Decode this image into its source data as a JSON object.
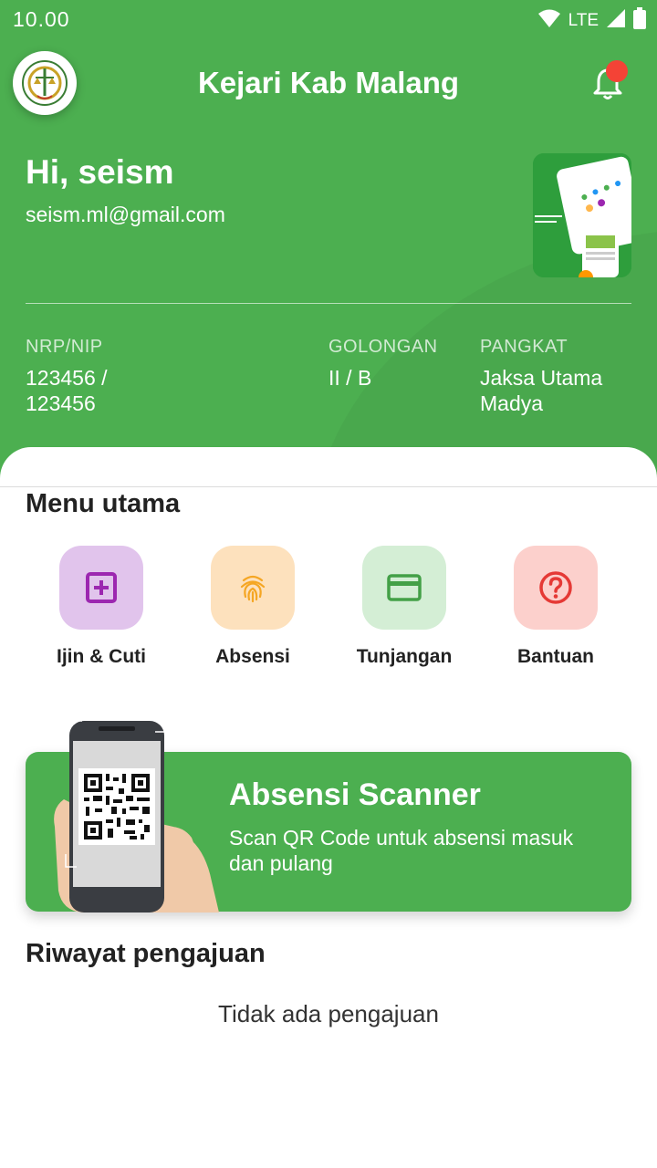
{
  "status_bar": {
    "time": "10.00",
    "network": "LTE",
    "icons": [
      "wifi-icon",
      "signal-icon",
      "battery-icon"
    ]
  },
  "header": {
    "title": "Kejari Kab Malang",
    "logo_icon": "kejaksaan-logo",
    "notification_icon": "bell-icon",
    "has_unread": true
  },
  "profile": {
    "greeting": "Hi, seism",
    "email": "seism.ml@gmail.com",
    "fields": [
      {
        "label": "NRP/NIP",
        "value": "123456 / 123456"
      },
      {
        "label": "GOLONGAN",
        "value": "II / B"
      },
      {
        "label": "PANGKAT",
        "value": "Jaksa Utama Madya"
      }
    ]
  },
  "menu": {
    "title": "Menu utama",
    "items": [
      {
        "label": "Ijin & Cuti",
        "icon": "add-box-icon",
        "tile_color": "#e1c4ec",
        "icon_color": "#9c27b0"
      },
      {
        "label": "Absensi",
        "icon": "fingerprint-icon",
        "tile_color": "#fde1bd",
        "icon_color": "#f5a623"
      },
      {
        "label": "Tunjangan",
        "icon": "card-icon",
        "tile_color": "#d4eed5",
        "icon_color": "#43a047"
      },
      {
        "label": "Bantuan",
        "icon": "help-circle-icon",
        "tile_color": "#fcd0cc",
        "icon_color": "#e53935"
      }
    ]
  },
  "scanner": {
    "title": "Absensi Scanner",
    "description": "Scan QR Code untuk absensi masuk dan pulang",
    "image_icon": "qr-phone-illustration"
  },
  "history": {
    "title": "Riwayat pengajuan",
    "empty_text": "Tidak ada pengajuan"
  },
  "colors": {
    "primary": "#4caf50",
    "notification_dot": "#f44336",
    "text": "#222222"
  }
}
